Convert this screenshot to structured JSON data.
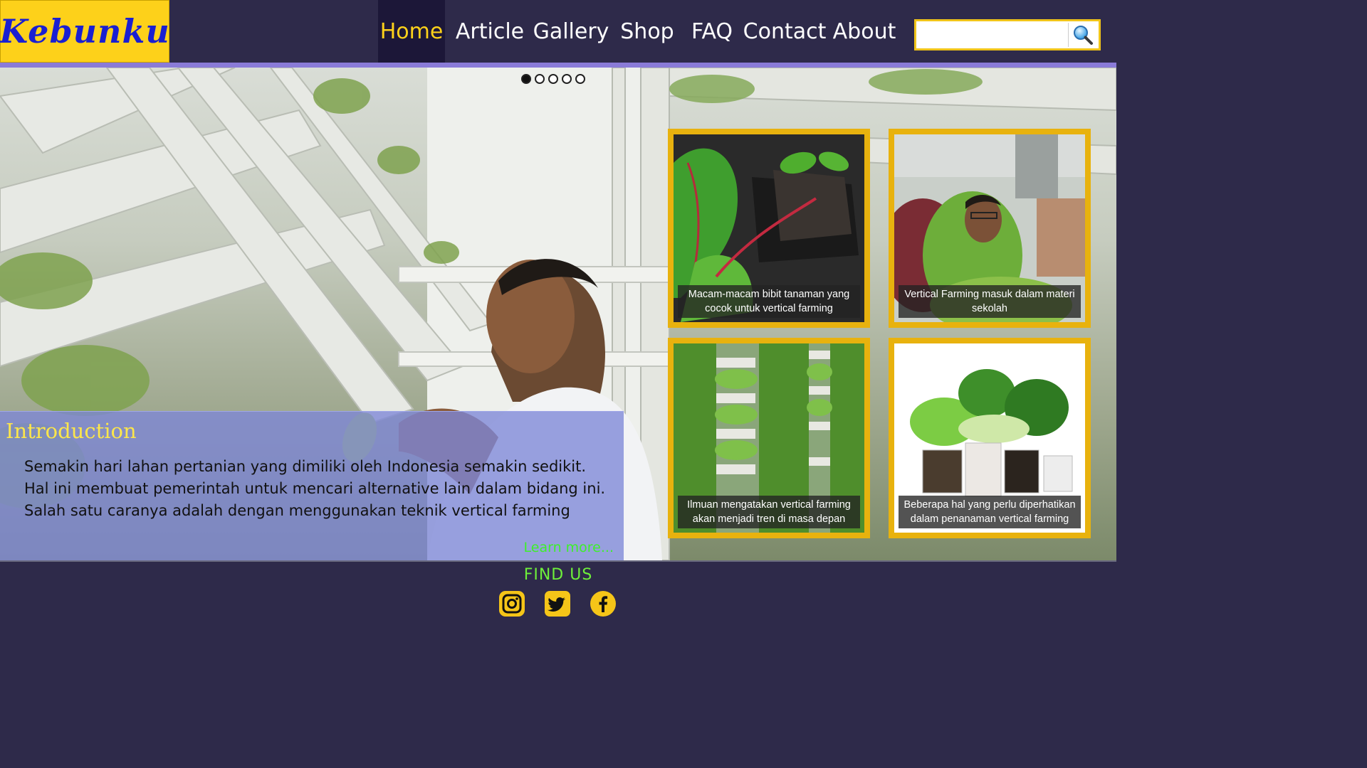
{
  "header": {
    "logo_text": "Kebunku",
    "nav": [
      {
        "label": "Home",
        "active": true
      },
      {
        "label": "Article",
        "active": false
      },
      {
        "label": "Gallery",
        "active": false
      },
      {
        "label": "Shop",
        "active": false
      },
      {
        "label": "FAQ",
        "active": false
      },
      {
        "label": "Contact",
        "active": false
      },
      {
        "label": "About",
        "active": false
      }
    ],
    "search": {
      "placeholder": "",
      "icon": "search-icon"
    }
  },
  "hero": {
    "slider": {
      "total": 5,
      "active_index": 0
    },
    "intro": {
      "title": "Introduction",
      "lines": [
        "Semakin hari lahan pertanian yang dimiliki oleh Indonesia semakin sedikit.",
        "Hal ini membuat pemerintah untuk mencari alternative lain dalam bidang ini.",
        "Salah satu caranya adalah dengan menggunakan teknik vertical farming"
      ],
      "learn_more": "Learn more..."
    },
    "cards": [
      {
        "caption": "Macam-macam bibit tanaman yang cocok untuk vertical farming"
      },
      {
        "caption": "Vertical Farming masuk dalam materi sekolah"
      },
      {
        "caption": "Ilmuan mengatakan vertical farming akan menjadi tren di masa depan"
      },
      {
        "caption": "Beberapa hal yang perlu diperhatikan dalam penanaman vertical farming"
      }
    ]
  },
  "footer": {
    "find_us": "FIND US",
    "social": [
      "instagram-icon",
      "twitter-icon",
      "facebook-icon"
    ]
  },
  "colors": {
    "header_bg": "#2e2a4a",
    "logo_bg": "#fdd11a",
    "accent_yellow": "#fdd11a",
    "card_border": "#e8b20e",
    "learn_more_green": "#3ef02a"
  }
}
